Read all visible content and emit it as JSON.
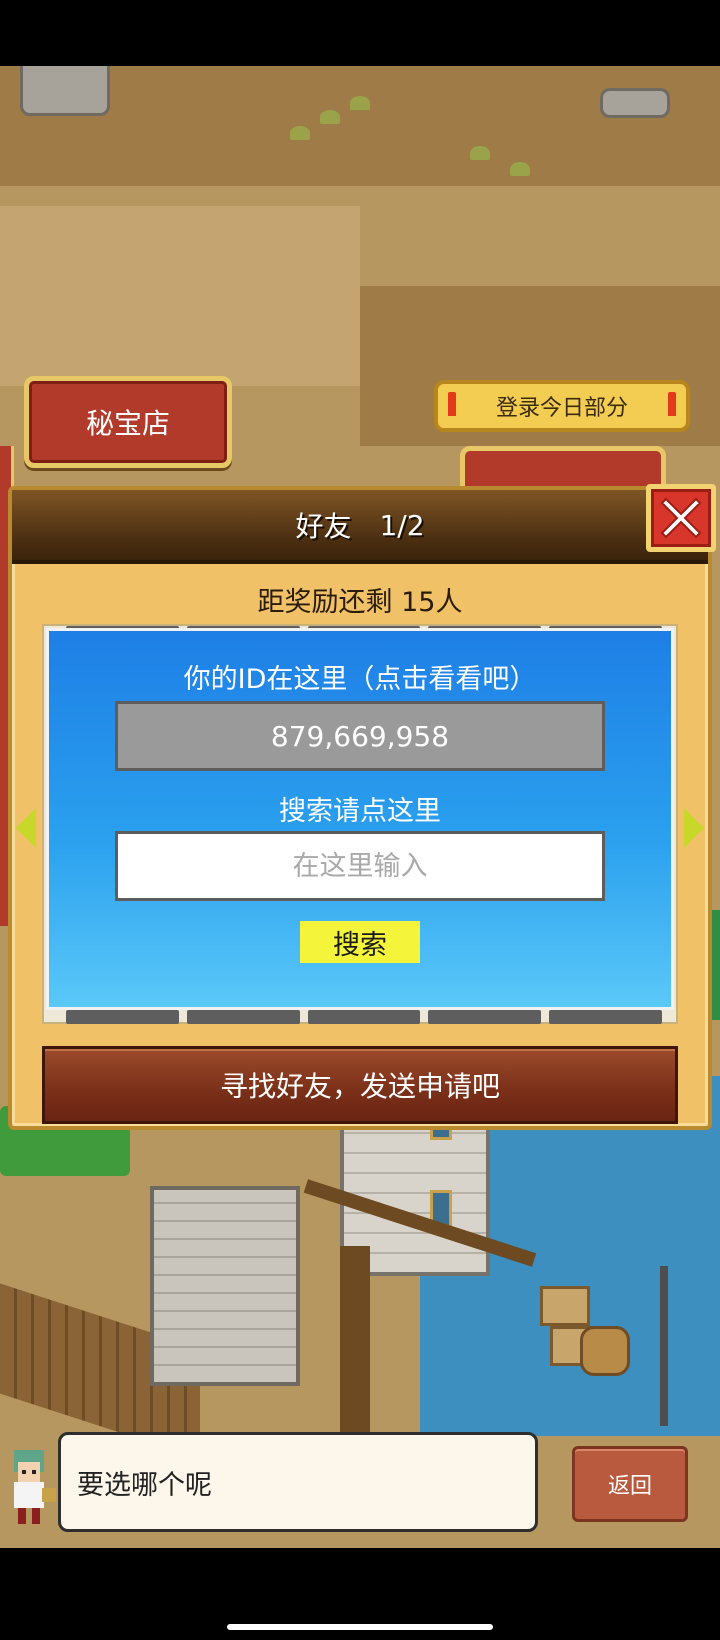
{
  "scene": {
    "shop_button_label": "秘宝店",
    "login_bonus_label": "登录今日部分",
    "excl_icon": "exclamation-icon"
  },
  "friends_dialog": {
    "title": "好友",
    "page": "1/2",
    "close_icon": "close-x-icon",
    "reward_text": "距奖励还剩 15人",
    "id_caption": "你的ID在这里（点击看看吧）",
    "id_value": "879,669,958",
    "search_caption": "搜索请点这里",
    "search_placeholder": "在这里输入",
    "search_button_label": "搜索",
    "find_friends_label": "寻找好友，发送申请吧",
    "prev_icon": "arrow-left-icon",
    "next_icon": "arrow-right-icon"
  },
  "message_bar": {
    "message": "要选哪个呢",
    "back_label": "返回"
  },
  "colors": {
    "dialog_bg": "#f0c166",
    "header_brown": "#4b2f12",
    "panel_blue": "#1e7fe6",
    "search_yellow": "#f4f43a",
    "close_red": "#d8362a",
    "shop_red": "#b23a2a"
  }
}
